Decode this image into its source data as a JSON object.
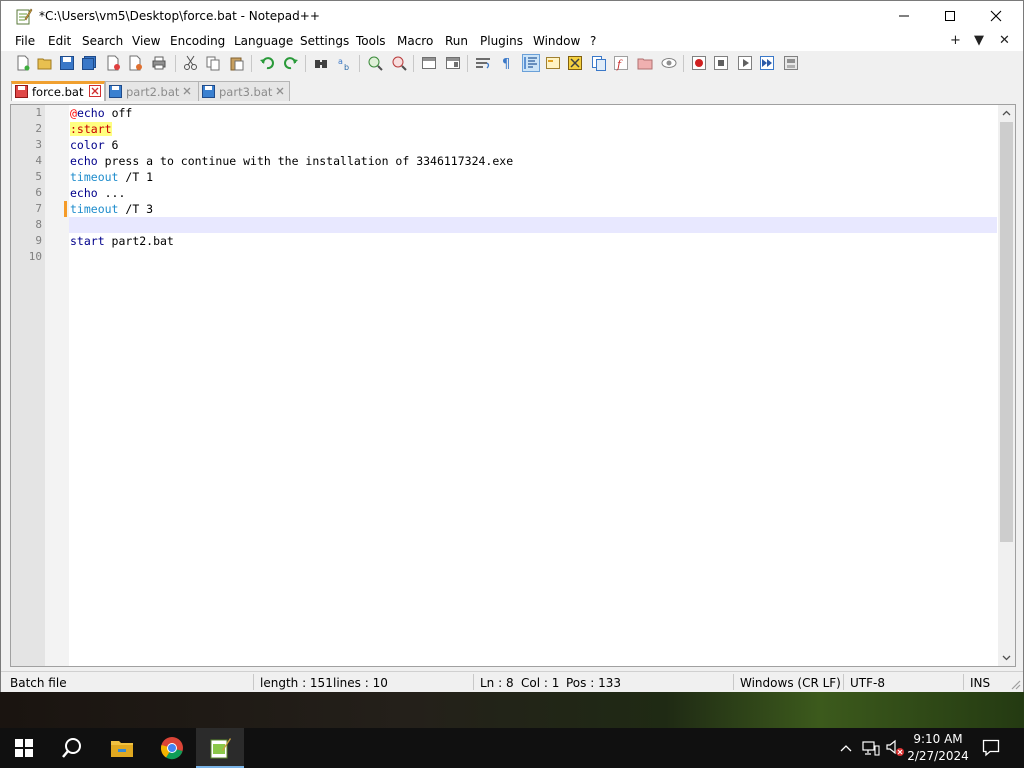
{
  "window": {
    "title": "*C:\\Users\\vm5\\Desktop\\force.bat - Notepad++"
  },
  "menu": {
    "items": [
      "File",
      "Edit",
      "Search",
      "View",
      "Encoding",
      "Language",
      "Settings",
      "Tools",
      "Macro",
      "Run",
      "Plugins",
      "Window",
      "?"
    ],
    "right": [
      "+",
      "▼",
      "✕"
    ]
  },
  "tabs": [
    {
      "label": "force.bat",
      "active": true
    },
    {
      "label": "part2.bat",
      "active": false
    },
    {
      "label": "part3.bat",
      "active": false
    }
  ],
  "editor": {
    "line_numbers": [
      "1",
      "2",
      "3",
      "4",
      "5",
      "6",
      "7",
      "8",
      "9",
      "10"
    ],
    "lines": [
      {
        "a": "@",
        "b": "echo",
        "c": " off"
      },
      {
        "label": ":start"
      },
      {
        "b": "color",
        "c": " 6"
      },
      {
        "b": "echo",
        "c": " press a to continue with the installation of 3346117324.exe"
      },
      {
        "b2": "timeout",
        "c": " /T 1"
      },
      {
        "b": "echo",
        "c": " ..."
      },
      {
        "b2": "timeout",
        "c": " /T 3"
      },
      {
        "c": ""
      },
      {
        "b": "start",
        "c": " part2.bat"
      },
      {
        "c": ""
      }
    ]
  },
  "status": {
    "file_type": "Batch file",
    "length": "length : 151",
    "lines": "lines : 10",
    "ln": "Ln : 8",
    "col": "Col : 1",
    "pos": "Pos : 133",
    "eol": "Windows (CR LF)",
    "encoding": "UTF-8",
    "mode": "INS"
  },
  "taskbar": {
    "time": "9:10 AM",
    "date": "2/27/2024"
  },
  "colors": {
    "keyword": "#00008b",
    "keyword2": "#1e8ccc",
    "tab_active_accent": "#f0a030",
    "current_line": "#e8e8ff"
  }
}
